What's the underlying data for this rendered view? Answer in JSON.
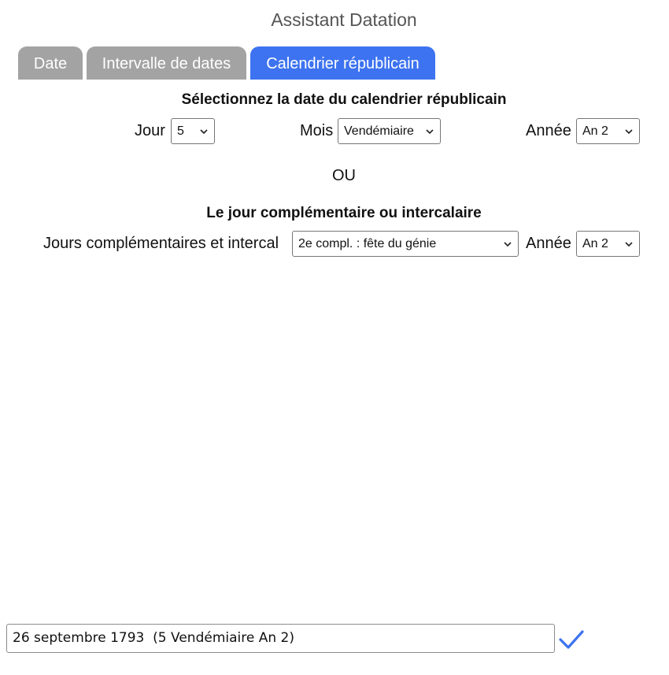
{
  "app": {
    "title": "Assistant Datation"
  },
  "tabs": [
    {
      "label": "Date",
      "active": false
    },
    {
      "label": "Intervalle de dates",
      "active": false
    },
    {
      "label": "Calendrier républicain",
      "active": true
    }
  ],
  "republican": {
    "heading": "Sélectionnez la date du calendrier républicain",
    "day_label": "Jour",
    "day_value": "5",
    "month_label": "Mois",
    "month_value": "Vendémiaire",
    "year_label": "Année",
    "year_value": "An 2"
  },
  "separator": "OU",
  "complementary": {
    "heading": "Le jour complémentaire ou intercalaire",
    "days_label": "Jours complémentaires et intercal",
    "days_value": "2e compl. : fête du génie",
    "year_label": "Année",
    "year_value": "An 2"
  },
  "result": {
    "value": "26 septembre 1793  (5 Vendémiaire An 2)"
  },
  "icons": {
    "dropdown": "chevron-down-icon",
    "confirm": "checkmark-icon"
  },
  "colors": {
    "accent": "#3d73f0",
    "tab_inactive": "#a3a3a3",
    "title": "#555555"
  }
}
